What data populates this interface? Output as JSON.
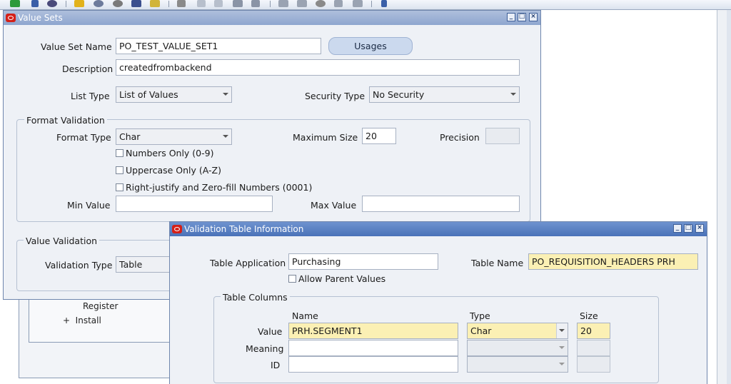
{
  "toolbar": {
    "icons": [
      "new-icon",
      "open-icon",
      "find-icon",
      "save-icon",
      "next-step-icon",
      "switch-responsibility-icon",
      "print-icon",
      "close-form-icon",
      "cut-icon",
      "copy-icon",
      "paste-icon",
      "clear-record-icon",
      "delete-icon",
      "edit-field-icon",
      "zoom-icon",
      "translations-icon",
      "attachments-icon",
      "folder-tools-icon",
      "help-icon"
    ]
  },
  "navigator_bg": {
    "items": [
      {
        "label": "Register"
      },
      {
        "label": "+  Install"
      }
    ]
  },
  "value_sets": {
    "title": "Value Sets",
    "value_set_name_label": "Value Set Name",
    "value_set_name": "PO_TEST_VALUE_SET1",
    "usages_button": "Usages",
    "description_label": "Description",
    "description": "createdfrombackend",
    "list_type_label": "List Type",
    "list_type": "List of Values",
    "security_type_label": "Security Type",
    "security_type": "No Security",
    "format_validation": {
      "title": "Format Validation",
      "format_type_label": "Format Type",
      "format_type": "Char",
      "maximum_size_label": "Maximum Size",
      "maximum_size": "20",
      "precision_label": "Precision",
      "precision": "",
      "numbers_only": "Numbers Only (0-9)",
      "uppercase_only": "Uppercase Only (A-Z)",
      "right_justify": "Right-justify and Zero-fill Numbers (0001)",
      "min_value_label": "Min Value",
      "min_value": "",
      "max_value_label": "Max Value",
      "max_value": ""
    },
    "value_validation": {
      "title": "Value Validation",
      "validation_type_label": "Validation Type",
      "validation_type": "Table"
    }
  },
  "validation_table": {
    "title": "Validation Table Information",
    "table_application_label": "Table Application",
    "table_application": "Purchasing",
    "table_name_label": "Table Name",
    "table_name": "PO_REQUISITION_HEADERS PRH",
    "allow_parent_values": "Allow Parent Values",
    "table_columns": {
      "title": "Table Columns",
      "headers": {
        "name": "Name",
        "type": "Type",
        "size": "Size"
      },
      "rows": [
        {
          "label": "Value",
          "name": "PRH.SEGMENT1",
          "type": "Char",
          "size": "20"
        },
        {
          "label": "Meaning",
          "name": "",
          "type": "",
          "size": ""
        },
        {
          "label": "ID",
          "name": "",
          "type": "",
          "size": ""
        }
      ]
    }
  }
}
